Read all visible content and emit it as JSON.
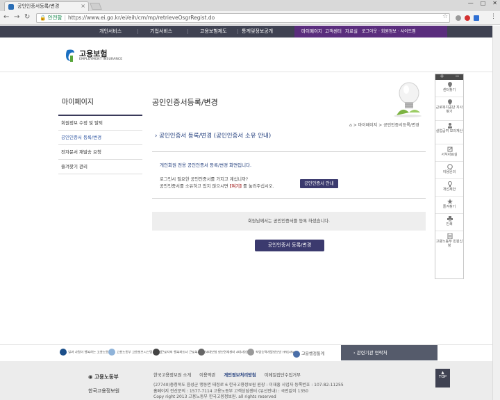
{
  "browser": {
    "tab_title": "공인인증서등록/변경",
    "tab_close": "×",
    "window_controls": [
      "—",
      "□",
      "✕"
    ],
    "secure_label": "안전함",
    "url": "https://www.ei.go.kr/ei/eih/cm/mp/retrieveOsgrRegist.do"
  },
  "topnav": {
    "items": [
      "개인서비스",
      "기업서비스",
      "고용보험제도",
      "통계및정보공개"
    ],
    "my_items": [
      "마이페이지",
      "고객센터",
      "자료실"
    ],
    "extra": "로그아웃 · 회원정보 · 사이트맵"
  },
  "logo": {
    "title": "고용보험",
    "subtitle": "EMPLOYMENT INSURANCE"
  },
  "leftmenu": {
    "title": "마이페이지",
    "items": [
      "회원정보 수정 및 탈퇴",
      "공인인증서 등록/변경",
      "전자문서 재발송 요청",
      "즐겨찾기 관리"
    ]
  },
  "main": {
    "page_title": "공인인증서등록/변경",
    "breadcrumb": "⌂ > 마이페이지 > 공인인증서등록/변경",
    "section_title": "공인인증서 등록/변경 (공인인증서 소유 안내)",
    "info1": "개인회원 전용 공인인증서 등록/변경 화면입니다.",
    "info2_line1": "로그인시 필요한 공인인증서를 가지고 계십니까?",
    "info2_line2_pre": "공인인증서를 소유하고 있지 않으시면 ",
    "info2_line2_bold": "[여기]",
    "info2_line2_post": " 를 눌러주십시오.",
    "cert_guide_button": "공인인증서 안내",
    "notice": "회원님께서는 공인인증서를 등록 하셨습니다.",
    "register_button": "공인인증서 등록/변경"
  },
  "quickmenu": {
    "head_plus": "+",
    "head_minus": "−",
    "items": [
      "센터찾기",
      "근로복지공단 지사찾기",
      "실업급여 모의계산",
      "서식자료실",
      "이용문의",
      "개선제안",
      "즐겨찾기",
      "인쇄",
      "고용노동부 민원신청"
    ]
  },
  "banner": {
    "items": [
      "일과 사람이 행복하는 고용노동부",
      "고용노동부 고용정보시스템 워크넷",
      "근로자의 행복파트너 근로복지공단",
      "4대보험 정보연계센터 4대사회보험",
      "직업능력개발정보망 HRD-Net",
      "고용행정통계"
    ],
    "related": "관련기관 연락처"
  },
  "footer": {
    "logo1": "고용노동부",
    "logo2": "한국고용정보원",
    "links": [
      "한국고용정보원 소개",
      "이용약관",
      "개인정보처리방침",
      "이메일집단수집거부"
    ],
    "addr1": "(27740)충청북도 음성군 맹동면 태정로 6 한국고용정보원     원장 : 이재흥     사업자 등록번호 : 107-82-11255",
    "addr2": "홈페이지 전산문의 : 1577-7114     고용노동부 고객상담센터 (유선안내) : 국번없이 1350",
    "addr3": "Copy right 2013 고용노동부 한국고용정보원. all rights reserved",
    "top_button": "TOP"
  }
}
